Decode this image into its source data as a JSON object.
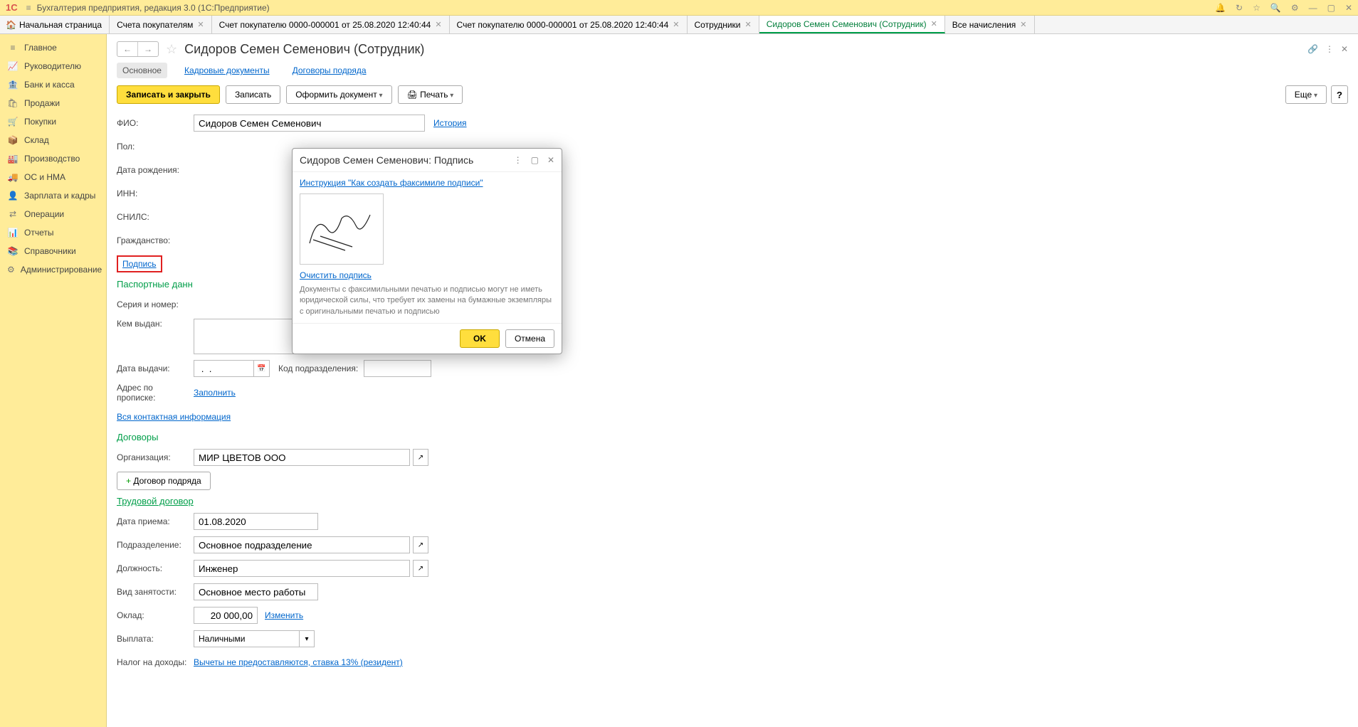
{
  "app": {
    "title": "Бухгалтерия предприятия, редакция 3.0  (1С:Предприятие)",
    "logo": "1С"
  },
  "tabs": {
    "home": "Начальная страница",
    "items": [
      {
        "label": "Счета покупателям"
      },
      {
        "label": "Счет покупателю 0000-000001 от 25.08.2020 12:40:44"
      },
      {
        "label": "Счет покупателю 0000-000001 от 25.08.2020 12:40:44"
      },
      {
        "label": "Сотрудники"
      },
      {
        "label": "Сидоров Семен Семенович (Сотрудник)",
        "active": true
      },
      {
        "label": "Все начисления"
      }
    ]
  },
  "sidebar": {
    "items": [
      {
        "icon": "≡",
        "label": "Главное"
      },
      {
        "icon": "📈",
        "label": "Руководителю"
      },
      {
        "icon": "🏦",
        "label": "Банк и касса"
      },
      {
        "icon": "🛍",
        "label": "Продажи"
      },
      {
        "icon": "🛒",
        "label": "Покупки"
      },
      {
        "icon": "📦",
        "label": "Склад"
      },
      {
        "icon": "🏭",
        "label": "Производство"
      },
      {
        "icon": "🚚",
        "label": "ОС и НМА"
      },
      {
        "icon": "👤",
        "label": "Зарплата и кадры"
      },
      {
        "icon": "⇄",
        "label": "Операции"
      },
      {
        "icon": "📊",
        "label": "Отчеты"
      },
      {
        "icon": "📚",
        "label": "Справочники"
      },
      {
        "icon": "⚙",
        "label": "Администрирование"
      }
    ]
  },
  "page": {
    "title": "Сидоров Семен Семенович (Сотрудник)",
    "subtabs": {
      "main": "Основное",
      "kadr": "Кадровые документы",
      "dogovor": "Договоры подряда"
    },
    "toolbar": {
      "save_close": "Записать и закрыть",
      "save": "Записать",
      "oformit": "Оформить документ",
      "print": "Печать",
      "more": "Еще",
      "help": "?"
    },
    "labels": {
      "fio": "ФИО:",
      "pol": "Пол:",
      "birthdate": "Дата рождения:",
      "inn": "ИНН:",
      "snils": "СНИЛС:",
      "citizenship": "Гражданство:",
      "signature": "Подпись",
      "history": "История",
      "passport_section": "Паспортные данн",
      "series": "Серия и номер:",
      "issued_by": "Кем выдан:",
      "issue_date": "Дата выдачи:",
      "dept_code": "Код подразделения:",
      "address": "Адрес по прописке:",
      "fill": "Заполнить",
      "all_contact": "Вся контактная информация",
      "contracts_section": "Договоры",
      "org": "Организация:",
      "add_contract": "Договор подряда",
      "trud_section": "Трудовой договор",
      "hire_date": "Дата приема:",
      "dept": "Подразделение:",
      "position": "Должность:",
      "employment": "Вид занятости:",
      "salary": "Оклад:",
      "change": "Изменить",
      "payment": "Выплата:",
      "tax": "Налог на доходы:",
      "tax_link": "Вычеты не предоставляются, ставка 13% (резидент)"
    },
    "values": {
      "fio": "Сидоров Семен Семенович",
      "issue_date": " .  .",
      "org": "МИР ЦВЕТОВ ООО",
      "hire_date": "01.08.2020",
      "dept": "Основное подразделение",
      "position": "Инженер",
      "employment": "Основное место работы",
      "salary": "20 000,00",
      "payment": "Наличными"
    }
  },
  "modal": {
    "title": "Сидоров Семен Семенович: Подпись",
    "instruction": "Инструкция \"Как создать факсимиле подписи\"",
    "clear": "Очистить подпись",
    "note": "Документы с факсимильными печатью и подписью могут не иметь юридической силы, что требует их замены на бумажные экземпляры с оригинальными печатью и подписью",
    "ok": "OK",
    "cancel": "Отмена"
  }
}
